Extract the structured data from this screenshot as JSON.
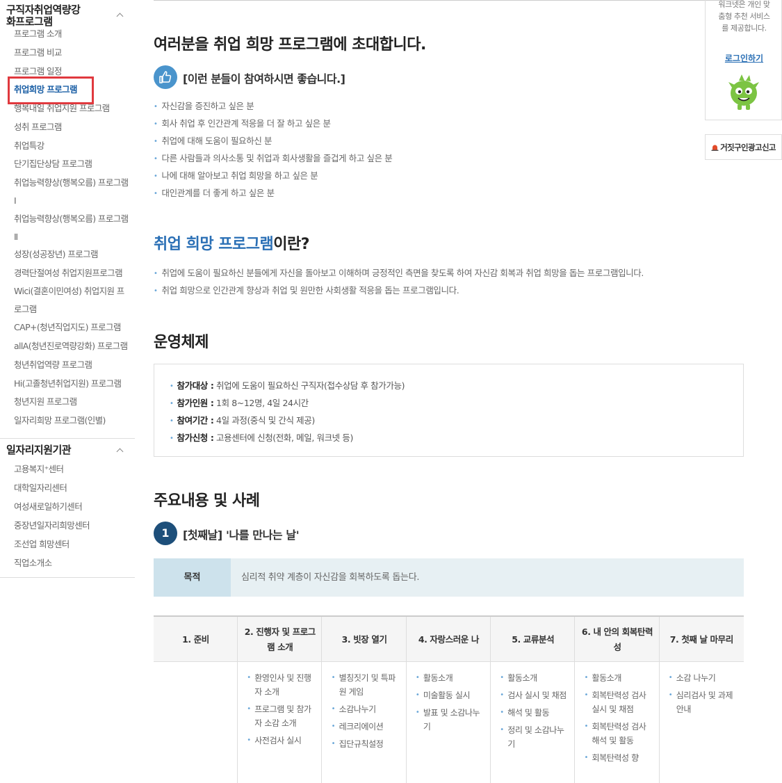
{
  "sidebar": {
    "section1_title": "구직자취업역량강화프로그램",
    "section1_items": [
      "프로그램 소개",
      "프로그램 비교",
      "프로그램 일정",
      "취업희망 프로그램",
      "행복내일 취업지원 프로그램",
      "성취 프로그램",
      "취업특강",
      "단기집단상담 프로그램",
      "취업능력향상(행복오름) 프로그램Ⅰ",
      "취업능력향상(행복오름) 프로그램Ⅱ",
      "성장(성공장년) 프로그램",
      "경력단절여성 취업지원프로그램",
      "Wici(결혼이민여성) 취업지원 프로그램",
      "CAP+(청년직업지도) 프로그램",
      "allA(청년진로역량강화) 프로그램",
      "청년취업역량 프로그램",
      "Hi(고졸청년취업지원) 프로그램",
      "청년지원 프로그램",
      "일자리희망 프로그램(인별)"
    ],
    "section2_title": "일자리지원기관",
    "section2_items": [
      "고용복지⁺센터",
      "대학일자리센터",
      "여성새로일하기센터",
      "중장년일자리희망센터",
      "조선업 희망센터",
      "직업소개소"
    ]
  },
  "main": {
    "title": "여러분을 취업 희망 프로그램에 초대합니다.",
    "target_heading": "[이런 분들이 참여하시면 좋습니다.]",
    "target_items": [
      "자신감을 증진하고 싶은 분",
      "회사 취업 후 인간관계 적응을 더 잘 하고 싶은 분",
      "취업에 대해 도움이 필요하신 분",
      "다른 사람들과 의사소통 및 취업과 회사생활을 즐겁게 하고 싶은 분",
      "나에 대해 알아보고 취업 희망을 하고 싶은 분",
      "대인관계를 더 좋게 하고 싶은 분"
    ],
    "what_is_accent": "취업 희망 프로그램",
    "what_is_rest": "이란?",
    "what_is_items": [
      "취업에 도움이 필요하신 분들에게 자신을 돌아보고 이해하며 긍정적인 측면을 찾도록 하여 자신감 회복과 취업 희망을 돕는 프로그램입니다.",
      "취업 희망으로 인간관계 향상과 취업 및 원만한 사회생활 적응을 돕는 프로그램입니다."
    ],
    "ops_title": "운영체제",
    "ops_rows": [
      {
        "label": "참가대상 :",
        "value": " 취업에 도움이 필요하신 구직자(접수상담 후 참가가능)"
      },
      {
        "label": "참가인원 :",
        "value": " 1회 8~12명, 4일 24시간"
      },
      {
        "label": "참여기간 :",
        "value": " 4일 과정(중식 및 간식 제공)"
      },
      {
        "label": "참가신청 :",
        "value": " 고용센터에 신청(전화, 메일, 워크넷 등)"
      }
    ],
    "content_title": "주요내용 및 사례",
    "day1_number": "1",
    "day1_title": "[첫째날] '나를 만나는 날'",
    "purpose_label": "목적",
    "purpose_text": "심리적 취약 계층이 자신감을 회복하도록 돕는다.",
    "steps": [
      {
        "head": "1. 준비",
        "items": []
      },
      {
        "head": "2. 진행자 및 프로그램 소개",
        "items": [
          "환영인사 및 진행자 소개",
          "프로그램 및 참가자 소감 소개",
          "사전검사 실시"
        ]
      },
      {
        "head": "3. 빗장 열기",
        "items": [
          "별칭짓기 및 특파원 게임",
          "소감나누기",
          "레크리에이션",
          "집단규칙설정"
        ]
      },
      {
        "head": "4. 자랑스러운 나",
        "items": [
          "활동소개",
          "미술활동 실시",
          "발표 및 소감나누기"
        ]
      },
      {
        "head": "5. 교류분석",
        "items": [
          "활동소개",
          "검사 실시 및 채점",
          "해석 및 활동",
          "정리 및 소감나누기"
        ]
      },
      {
        "head": "6. 내 안의 회복탄력성",
        "items": [
          "활동소개",
          "회복탄력성 검사 실시 및 채점",
          "회복탄력성 검사 해석 및 활동",
          "회복탄력성 향"
        ]
      },
      {
        "head": "7. 첫째 날 마무리",
        "items": [
          "소감 나누기",
          "심리검사 및 과제 안내"
        ]
      }
    ]
  },
  "right_panel": {
    "promo_text": "워크넷은 개인 맞춤형 추천 서비스를 제공합니다.",
    "login_label": "로그인하기",
    "report_label": "거짓구인광고신고"
  },
  "colors": {
    "accent_blue": "#2a6fb5",
    "highlight_red": "#e0393e",
    "step_circle": "#1d4f7a",
    "thumb_circle": "#4a94cc",
    "purpose_bg": "#e7f0f3"
  },
  "icons": [
    "chevron-up-icon",
    "thumbs-up-icon",
    "mascot-icon",
    "siren-icon"
  ]
}
